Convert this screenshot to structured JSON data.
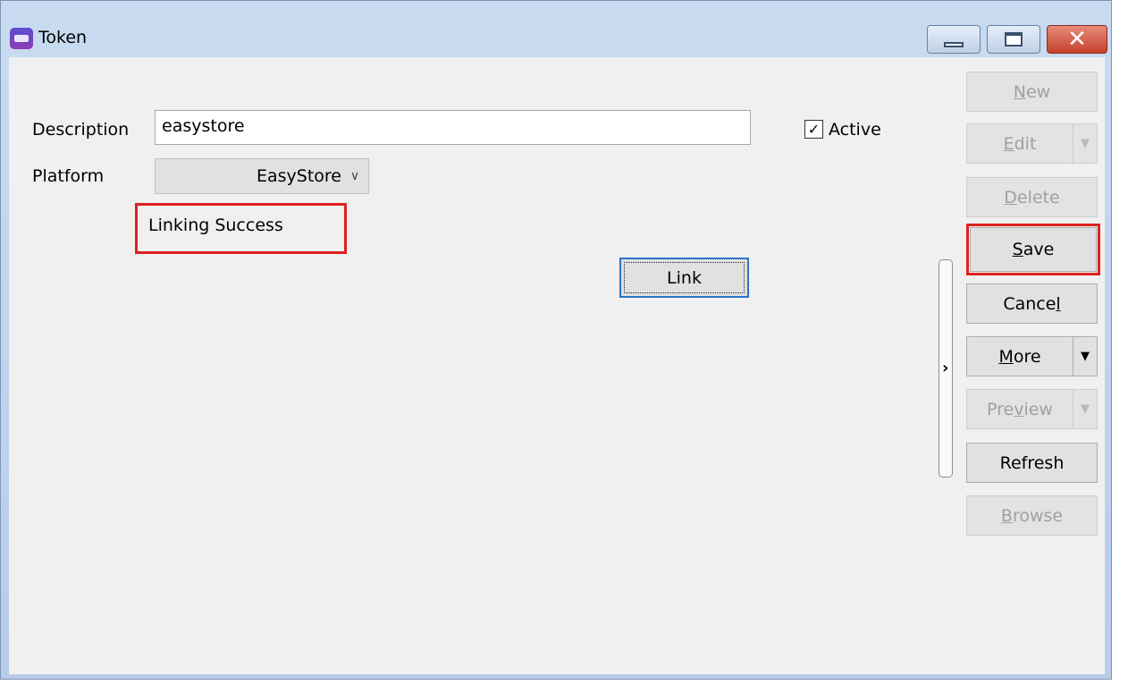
{
  "window": {
    "title": "Token"
  },
  "form": {
    "description_label": "Description",
    "description_value": "easystore",
    "platform_label": "Platform",
    "platform_value": "EasyStore",
    "status_text": "Linking Success",
    "link_label": "Link",
    "active_label": "Active",
    "active_checked": true
  },
  "toolbar": {
    "new": {
      "pre": "",
      "key": "N",
      "post": "ew"
    },
    "edit": {
      "pre": "",
      "key": "E",
      "post": "dit"
    },
    "delete": {
      "pre": "",
      "key": "D",
      "post": "elete"
    },
    "save": {
      "pre": "",
      "key": "S",
      "post": "ave"
    },
    "cancel": {
      "pre": "Cance",
      "key": "l",
      "post": ""
    },
    "more": {
      "pre": "",
      "key": "M",
      "post": "ore"
    },
    "preview": {
      "pre": "Pre",
      "key": "v",
      "post": "iew"
    },
    "refresh": {
      "pre": "Refresh",
      "key": "",
      "post": ""
    },
    "browse": {
      "pre": "",
      "key": "B",
      "post": "rowse"
    }
  },
  "colors": {
    "highlight": "#e02020",
    "focus": "#2a74c6"
  }
}
